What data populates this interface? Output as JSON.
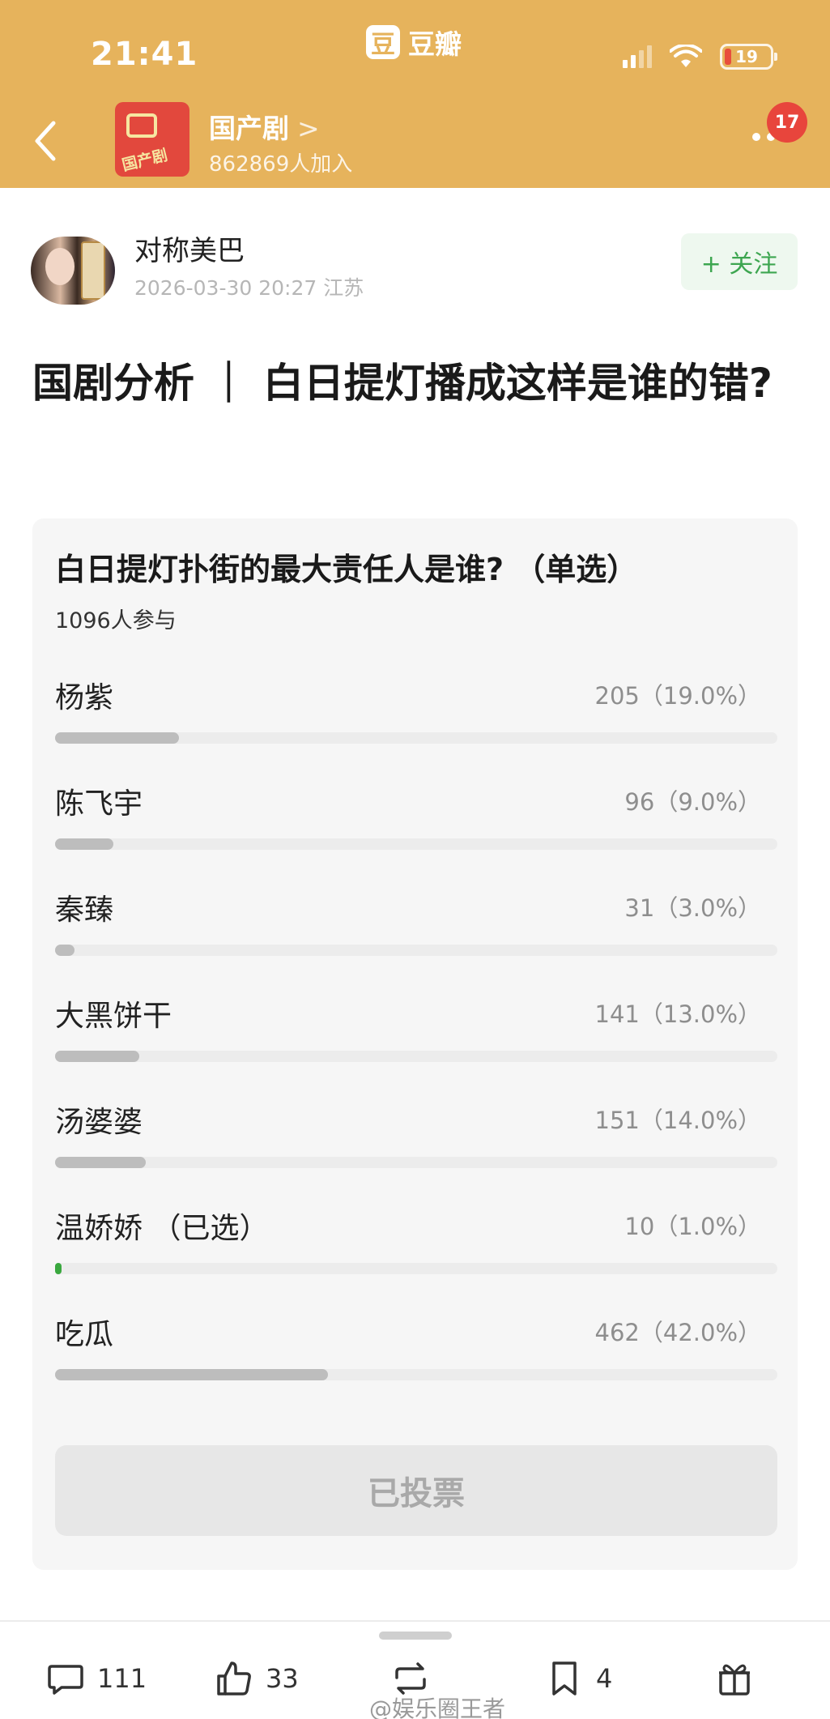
{
  "status_bar": {
    "time": "21:41",
    "app_logo_char": "豆",
    "app_brand": "豆瓣",
    "battery": "19"
  },
  "group": {
    "name": "国产剧",
    "chevron": ">",
    "members": "862869人加入",
    "avatar_text": "国产剧",
    "notification_count": "17"
  },
  "author": {
    "name": "对称美巴",
    "meta": "2026-03-30 20:27  江苏",
    "follow_label": "+ 关注"
  },
  "post": {
    "title": "国剧分析 ｜ 白日提灯播成这样是谁的错?"
  },
  "poll": {
    "question": "白日提灯扑街的最大责任人是谁? （单选）",
    "participants": "1096人参与",
    "options": [
      {
        "label": "杨紫",
        "stat": "205（19.0%）",
        "percent": 19.0,
        "selected": false
      },
      {
        "label": "陈飞宇",
        "stat": "96（9.0%）",
        "percent": 9.0,
        "selected": false
      },
      {
        "label": "秦臻",
        "stat": "31（3.0%）",
        "percent": 3.0,
        "selected": false
      },
      {
        "label": "大黑饼干",
        "stat": "141（13.0%）",
        "percent": 13.0,
        "selected": false
      },
      {
        "label": "汤婆婆",
        "stat": "151（14.0%）",
        "percent": 14.0,
        "selected": false
      },
      {
        "label": "温娇娇 （已选）",
        "stat": "10（1.0%）",
        "percent": 1.0,
        "selected": true
      },
      {
        "label": "吃瓜",
        "stat": "462（42.0%）",
        "percent": 42.0,
        "selected": false
      }
    ],
    "voted_label": "已投票"
  },
  "actions": {
    "comments": "111",
    "likes": "33",
    "collects": "4"
  },
  "watermark": "@娱乐圈王者",
  "colors": {
    "header_bg": "#e6b35c",
    "follow_text": "#3da650",
    "selected_bar": "#3aa83f",
    "bar": "#bdbdbd",
    "badge": "#e8453c"
  }
}
